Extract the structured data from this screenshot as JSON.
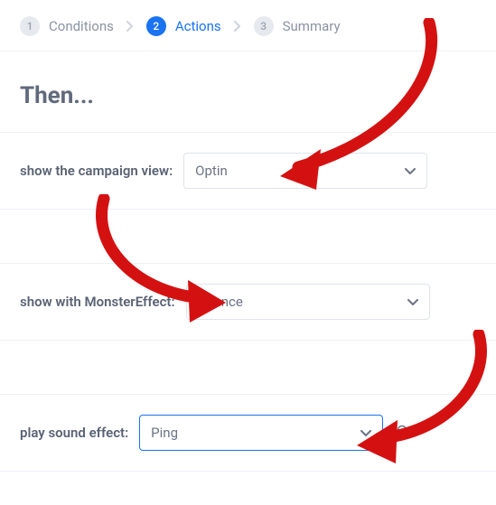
{
  "wizard": {
    "step1": {
      "num": "1",
      "label": "Conditions"
    },
    "step2": {
      "num": "2",
      "label": "Actions"
    },
    "step3": {
      "num": "3",
      "label": "Summary"
    }
  },
  "heading": "Then...",
  "rows": {
    "campaign_view": {
      "label": "show the campaign view:",
      "value": "Optin"
    },
    "monster_effect": {
      "label": "show with MonsterEffect:",
      "value": "Bounce"
    },
    "sound_effect": {
      "label": "play sound effect:",
      "value": "Ping"
    }
  },
  "annotations": {
    "arrow_color": "#d41111"
  }
}
